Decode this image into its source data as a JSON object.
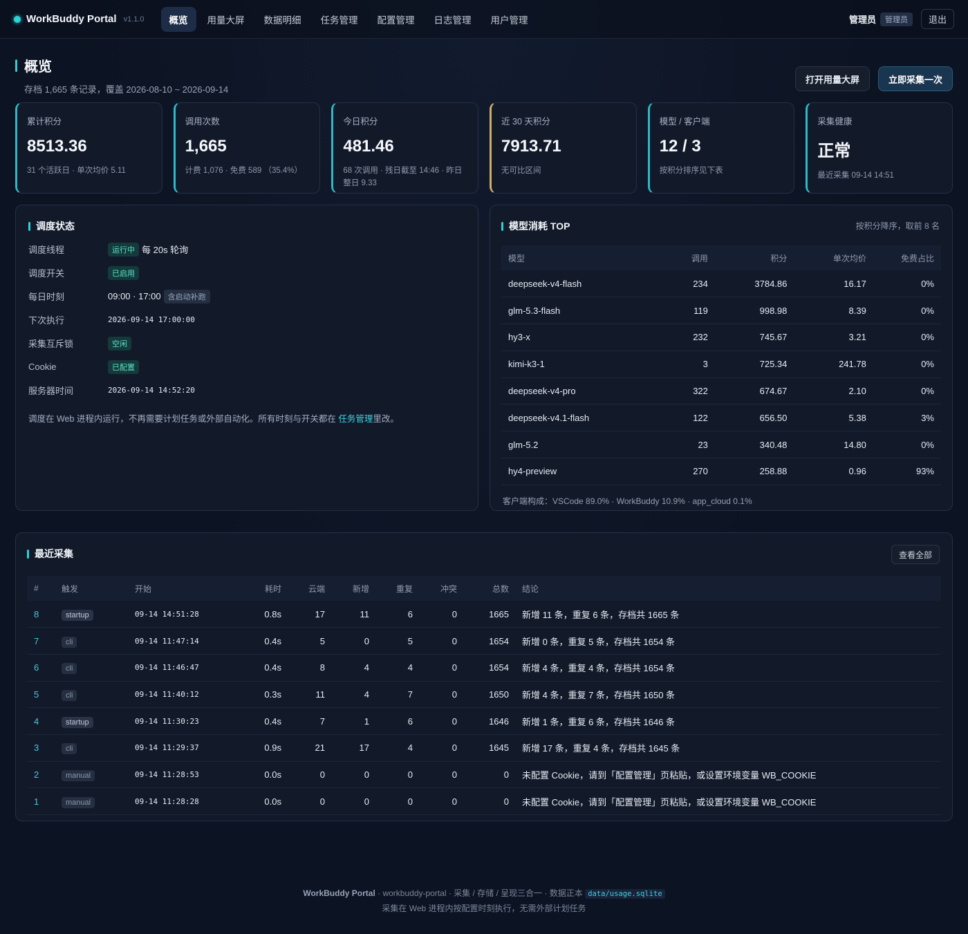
{
  "brand": {
    "name": "WorkBuddy Portal",
    "version": "v1.1.0"
  },
  "nav": [
    {
      "label": "概览",
      "active": true
    },
    {
      "label": "用量大屏"
    },
    {
      "label": "数据明细"
    },
    {
      "label": "任务管理"
    },
    {
      "label": "配置管理"
    },
    {
      "label": "日志管理"
    },
    {
      "label": "用户管理"
    }
  ],
  "user": {
    "name": "管理员",
    "role": "管理员",
    "logout": "退出"
  },
  "page": {
    "title": "概览",
    "subtitle": "存档 1,665 条记录，覆盖 2026-08-10 ~ 2026-09-14",
    "btn_dashboard": "打开用量大屏",
    "btn_collect": "立即采集一次"
  },
  "stats": [
    {
      "label": "累计积分",
      "value": "8513.36",
      "note": "31 个活跃日 · 单次均价 5.11"
    },
    {
      "label": "调用次数",
      "value": "1,665",
      "note": "计费 1,076 · 免费 589 （35.4%）"
    },
    {
      "label": "今日积分",
      "value": "481.46",
      "note": "68 次调用 · 残日截至 14:46 · 昨日整日 9.33"
    },
    {
      "label": "近 30 天积分",
      "value": "7913.71",
      "note": "无可比区间"
    },
    {
      "label": "模型 / 客户端",
      "value": "12 / 3",
      "note": "按积分排序见下表"
    },
    {
      "label": "采集健康",
      "value": "正常",
      "note": "最近采集 09-14 14:51"
    }
  ],
  "schedule": {
    "title": "调度状态",
    "rows": {
      "thread": {
        "key": "调度线程",
        "tag": "运行中",
        "text": "每 20s 轮询"
      },
      "switch": {
        "key": "调度开关",
        "tag": "已启用"
      },
      "daily": {
        "key": "每日时刻",
        "text": "09:00 · 17:00",
        "tag": "含启动补跑"
      },
      "next": {
        "key": "下次执行",
        "text": "2026-09-14 17:00:00"
      },
      "lock": {
        "key": "采集互斥锁",
        "tag": "空闲"
      },
      "cookie": {
        "key": "Cookie",
        "tag": "已配置"
      },
      "server_time": {
        "key": "服务器时间",
        "text": "2026-09-14 14:52:20"
      }
    },
    "note_pre": "调度在 Web 进程内运行，不再需要计划任务或外部自动化。所有时刻与开关都在 ",
    "note_link": "任务管理",
    "note_post": "里改。"
  },
  "models": {
    "title": "模型消耗 TOP",
    "aside": "按积分降序，取前 8 名",
    "headers": [
      "模型",
      "调用",
      "积分",
      "单次均价",
      "免费占比"
    ],
    "rows": [
      [
        "deepseek-v4-flash",
        "234",
        "3784.86",
        "16.17",
        "0%"
      ],
      [
        "glm-5.3-flash",
        "119",
        "998.98",
        "8.39",
        "0%"
      ],
      [
        "hy3-x",
        "232",
        "745.67",
        "3.21",
        "0%"
      ],
      [
        "kimi-k3-1",
        "3",
        "725.34",
        "241.78",
        "0%"
      ],
      [
        "deepseek-v4-pro",
        "322",
        "674.67",
        "2.10",
        "0%"
      ],
      [
        "deepseek-v4.1-flash",
        "122",
        "656.50",
        "5.38",
        "3%"
      ],
      [
        "glm-5.2",
        "23",
        "340.48",
        "14.80",
        "0%"
      ],
      [
        "hy4-preview",
        "270",
        "258.88",
        "0.96",
        "93%"
      ]
    ],
    "client_mix": "客户端构成：VSCode 89.0% · WorkBuddy 10.9% · app_cloud 0.1%"
  },
  "recent": {
    "title": "最近采集",
    "view_all": "查看全部",
    "headers": [
      "#",
      "触发",
      "开始",
      "耗时",
      "云端",
      "新增",
      "重复",
      "冲突",
      "总数",
      "结论"
    ],
    "rows": [
      [
        "8",
        "startup",
        "09-14 14:51:28",
        "0.8s",
        "17",
        "11",
        "6",
        "0",
        "1665",
        "新增 11 条，重复 6 条，存档共 1665 条"
      ],
      [
        "7",
        "cli",
        "09-14 11:47:14",
        "0.4s",
        "5",
        "0",
        "5",
        "0",
        "1654",
        "新增 0 条，重复 5 条，存档共 1654 条"
      ],
      [
        "6",
        "cli",
        "09-14 11:46:47",
        "0.4s",
        "8",
        "4",
        "4",
        "0",
        "1654",
        "新增 4 条，重复 4 条，存档共 1654 条"
      ],
      [
        "5",
        "cli",
        "09-14 11:40:12",
        "0.3s",
        "11",
        "4",
        "7",
        "0",
        "1650",
        "新增 4 条，重复 7 条，存档共 1650 条"
      ],
      [
        "4",
        "startup",
        "09-14 11:30:23",
        "0.4s",
        "7",
        "1",
        "6",
        "0",
        "1646",
        "新增 1 条，重复 6 条，存档共 1646 条"
      ],
      [
        "3",
        "cli",
        "09-14 11:29:37",
        "0.9s",
        "21",
        "17",
        "4",
        "0",
        "1645",
        "新增 17 条，重复 4 条，存档共 1645 条"
      ],
      [
        "2",
        "manual",
        "09-14 11:28:53",
        "0.0s",
        "0",
        "0",
        "0",
        "0",
        "0",
        "未配置 Cookie，请到「配置管理」页粘贴，或设置环境变量 WB_COOKIE"
      ],
      [
        "1",
        "manual",
        "09-14 11:28:28",
        "0.0s",
        "0",
        "0",
        "0",
        "0",
        "0",
        "未配置 Cookie，请到「配置管理」页粘贴，或设置环境变量 WB_COOKIE"
      ]
    ]
  },
  "footer": {
    "brand": "WorkBuddy Portal",
    "text": " · workbuddy-portal · 采集 / 存储 / 呈现三合一 · 数据正本 ",
    "code": "data/usage.sqlite",
    "line2": "采集在 Web 进程内按配置时刻执行，无需外部计划任务"
  },
  "colors": {
    "accent": "#2fd1d6",
    "accent_amber": "#d0ad6a",
    "bg": "#0c1322",
    "card": "#121a2a"
  }
}
